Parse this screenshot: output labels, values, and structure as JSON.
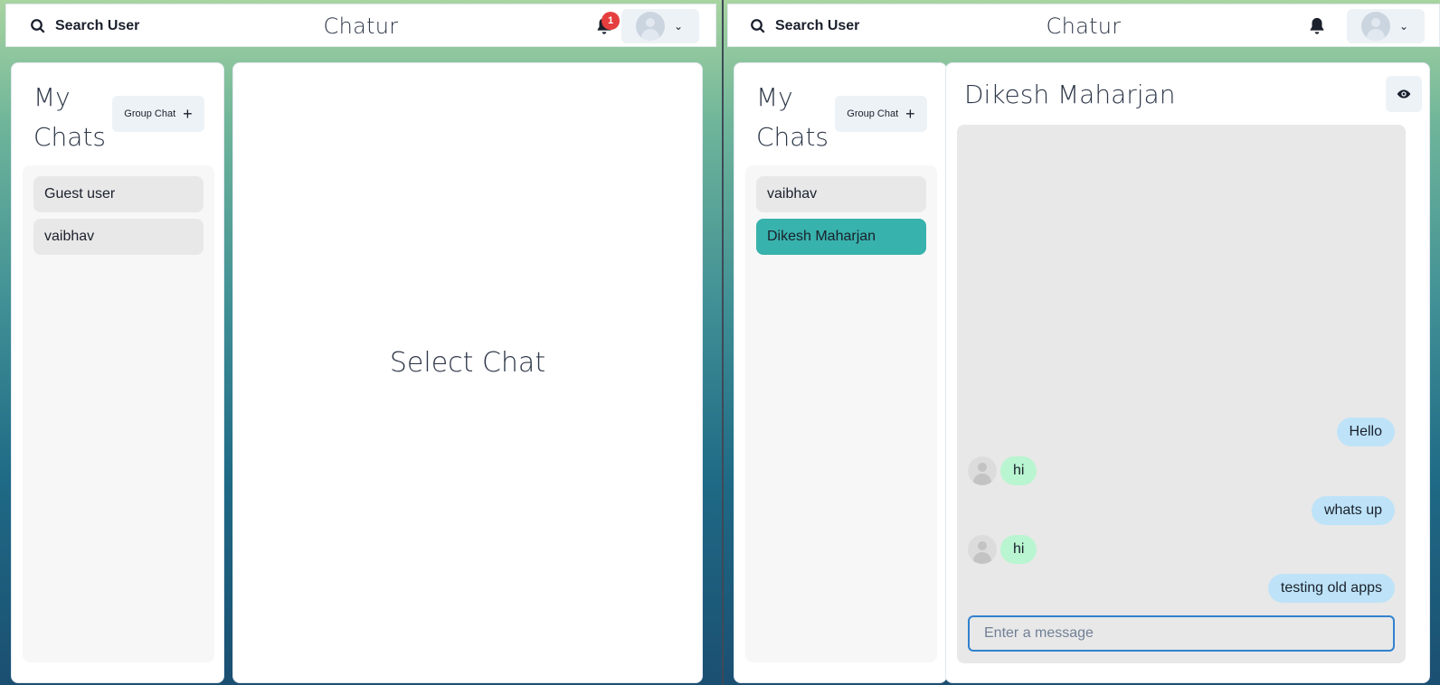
{
  "left": {
    "topbar": {
      "search_label": "Search User",
      "brand": "Chatur",
      "notification_count": "1"
    },
    "mychats": {
      "title": "My Chats",
      "group_chat_label": "Group Chat",
      "chats": [
        {
          "name": "Guest user",
          "active": false
        },
        {
          "name": "vaibhav",
          "active": false
        }
      ]
    },
    "chatbox": {
      "empty_text": "Select Chat"
    }
  },
  "right": {
    "topbar": {
      "search_label": "Search User",
      "brand": "Chatur"
    },
    "mychats": {
      "title": "My Chats",
      "group_chat_label": "Group Chat",
      "chats": [
        {
          "name": "vaibhav",
          "active": false
        },
        {
          "name": "Dikesh Maharjan",
          "active": true
        }
      ]
    },
    "chatbox": {
      "header": "Dikesh Maharjan",
      "messages": [
        {
          "from": "me",
          "text": "Hello"
        },
        {
          "from": "them",
          "text": "hi"
        },
        {
          "from": "me",
          "text": "whats up"
        },
        {
          "from": "them",
          "text": "hi"
        },
        {
          "from": "me",
          "text": "testing old apps"
        }
      ],
      "input_placeholder": "Enter a message"
    }
  },
  "colors": {
    "accent_active_chat": "#38b2ac",
    "my_bubble": "#bee3f8",
    "their_bubble": "#b9f5d0",
    "badge": "#e53e3e",
    "input_focus": "#3182ce"
  },
  "icons": {
    "search": "search-icon",
    "bell": "bell-icon",
    "chevron": "chevron-down-icon",
    "plus": "plus-icon",
    "eye": "eye-icon",
    "avatar": "user-avatar-icon"
  }
}
